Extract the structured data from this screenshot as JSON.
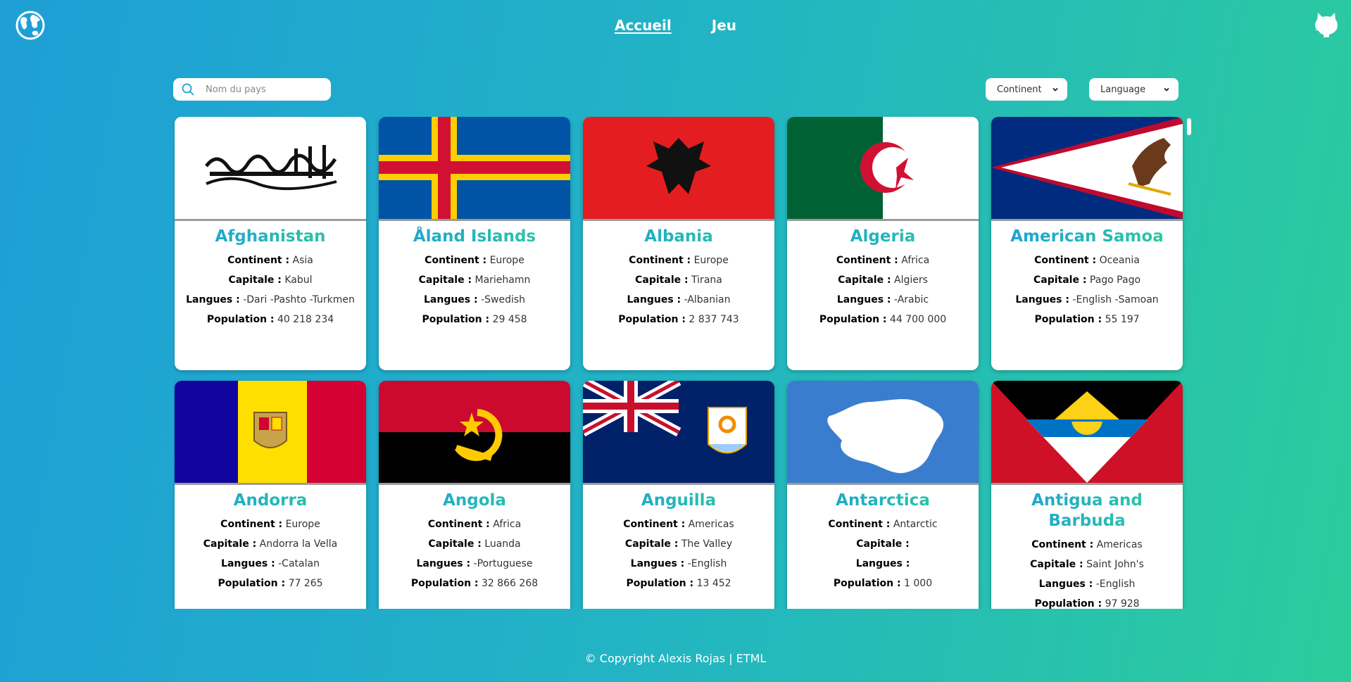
{
  "nav": {
    "home": "Accueil",
    "game": "Jeu"
  },
  "search": {
    "placeholder": "Nom du pays"
  },
  "filters": {
    "continent": "Continent",
    "language": "Language"
  },
  "labels": {
    "continent": "Continent :",
    "capital": "Capitale :",
    "languages": "Langues :",
    "population": "Population :"
  },
  "countries": [
    {
      "name": "Afghanistan",
      "continent": "Asia",
      "capital": "Kabul",
      "languages": "-Dari -Pashto -Turkmen",
      "population": "40 218 234"
    },
    {
      "name": "Åland Islands",
      "continent": "Europe",
      "capital": "Mariehamn",
      "languages": "-Swedish",
      "population": "29 458"
    },
    {
      "name": "Albania",
      "continent": "Europe",
      "capital": "Tirana",
      "languages": "-Albanian",
      "population": "2 837 743"
    },
    {
      "name": "Algeria",
      "continent": "Africa",
      "capital": "Algiers",
      "languages": "-Arabic",
      "population": "44 700 000"
    },
    {
      "name": "American Samoa",
      "continent": "Oceania",
      "capital": "Pago Pago",
      "languages": "-English -Samoan",
      "population": "55 197"
    },
    {
      "name": "Andorra",
      "continent": "Europe",
      "capital": "Andorra la Vella",
      "languages": "-Catalan",
      "population": "77 265"
    },
    {
      "name": "Angola",
      "continent": "Africa",
      "capital": "Luanda",
      "languages": "-Portuguese",
      "population": "32 866 268"
    },
    {
      "name": "Anguilla",
      "continent": "Americas",
      "capital": "The Valley",
      "languages": "-English",
      "population": "13 452"
    },
    {
      "name": "Antarctica",
      "continent": "Antarctic",
      "capital": "",
      "languages": "",
      "population": "1 000"
    },
    {
      "name": "Antigua and Barbuda",
      "continent": "Americas",
      "capital": "Saint John's",
      "languages": "-English",
      "population": "97 928"
    }
  ],
  "footer": "© Copyright Alexis Rojas | ETML",
  "icons": {
    "logo": "globe-icon",
    "repo": "github-icon",
    "search": "search-icon",
    "dropdown": "chevron-down-icon"
  },
  "colors": {
    "accent_start": "#1e9fd6",
    "accent_end": "#2ccc9c"
  }
}
